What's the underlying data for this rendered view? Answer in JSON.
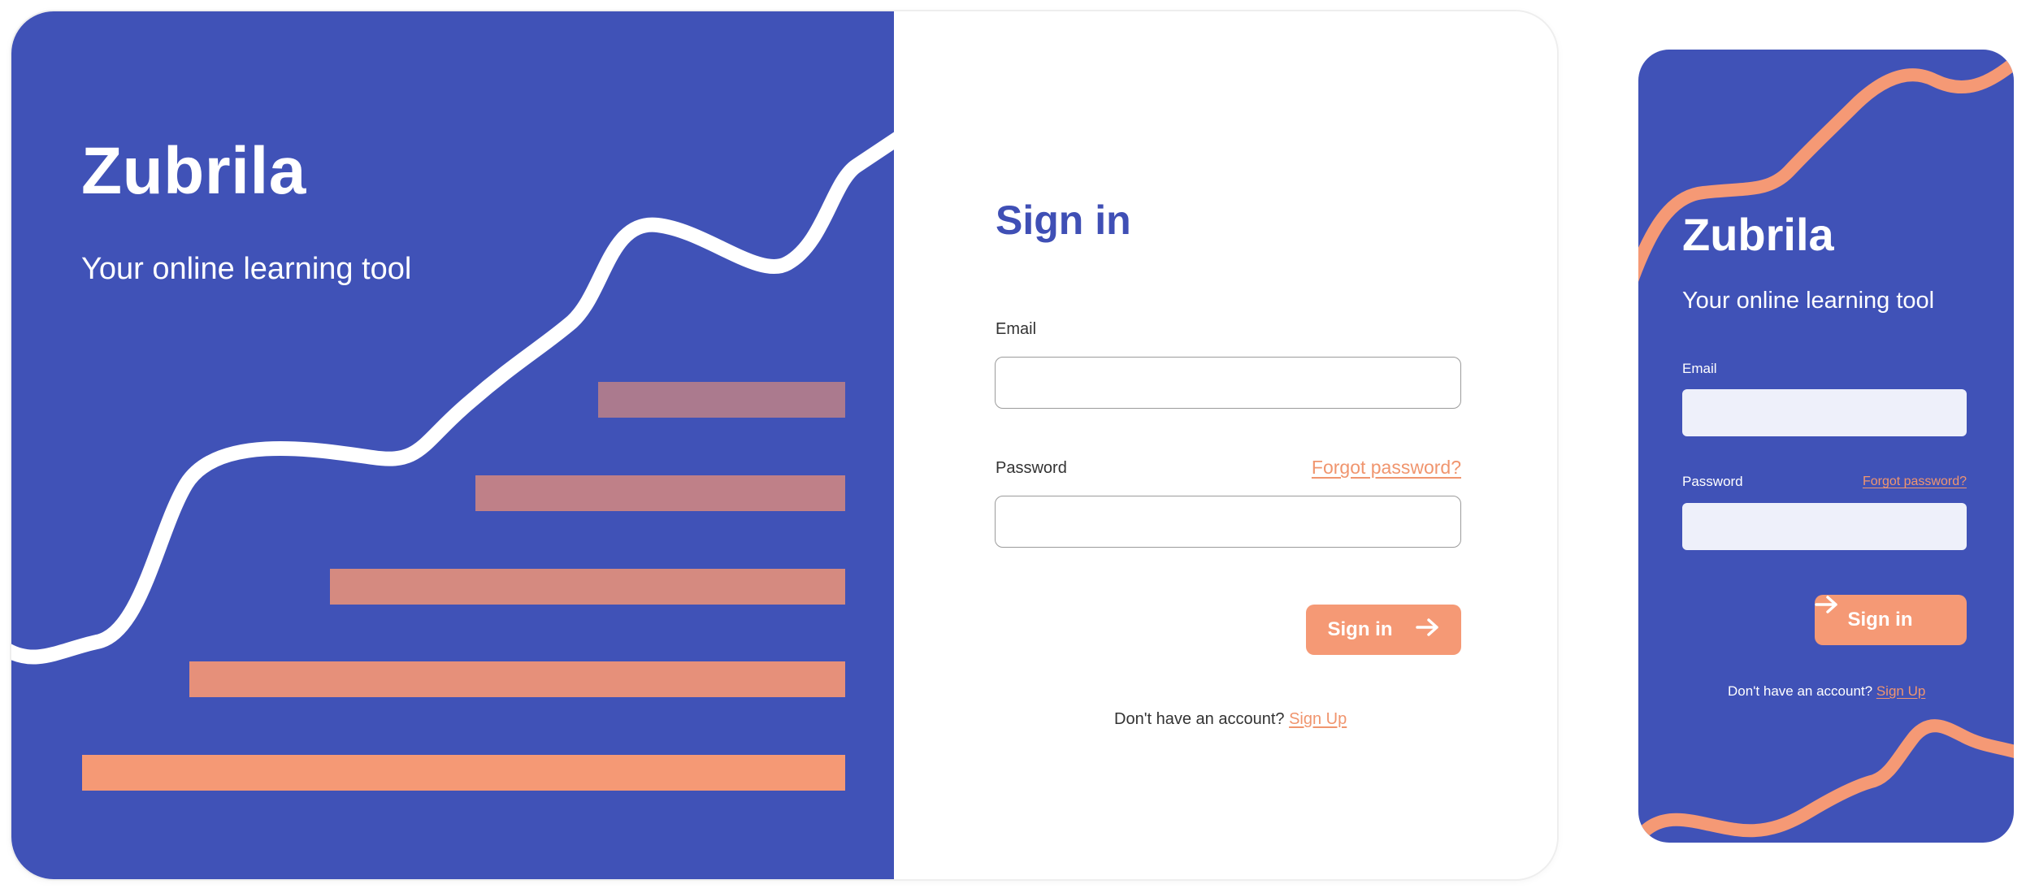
{
  "colors": {
    "primary": "#4052b7",
    "accent": "#f59975",
    "link": "#f0956e",
    "input_bg_mobile": "#eef0fa"
  },
  "desktop": {
    "hero": {
      "brand": "Zubrila",
      "tagline": "Your online learning tool"
    },
    "form": {
      "title": "Sign in",
      "email_label": "Email",
      "email_value": "",
      "password_label": "Password",
      "password_value": "",
      "forgot_password": "Forgot password?",
      "submit_label": "Sign in",
      "submit_icon": "arrow-right-icon",
      "signup_prompt": "Don't have an account?",
      "signup_link": "Sign Up"
    }
  },
  "mobile": {
    "brand": "Zubrila",
    "tagline": "Your online learning tool",
    "email_label": "Email",
    "email_value": "",
    "password_label": "Password",
    "password_value": "",
    "forgot_password": "Forgot password?",
    "submit_label": "Sign in",
    "submit_icon": "arrow-right-icon",
    "signup_prompt": "Don't have an account?",
    "signup_link": "Sign Up"
  }
}
